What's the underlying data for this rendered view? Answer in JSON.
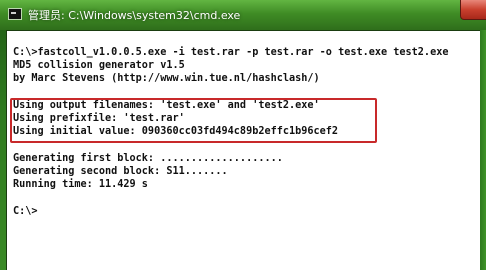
{
  "window": {
    "title": "管理员: C:\\Windows\\system32\\cmd.exe"
  },
  "console": {
    "lines": [
      "C:\\>fastcoll_v1.0.0.5.exe -i test.rar -p test.rar -o test.exe test2.exe",
      "MD5 collision generator v1.5",
      "by Marc Stevens (http://www.win.tue.nl/hashclash/)",
      "",
      "Using output filenames: 'test.exe' and 'test2.exe'",
      "Using prefixfile: 'test.rar'",
      "Using initial value: 090360cc03fd494c89b2effc1b96cef2",
      "",
      "Generating first block: ....................",
      "Generating second block: S11.......",
      "Running time: 11.429 s",
      "",
      "C:\\>"
    ]
  },
  "colors": {
    "highlight_border": "#c8292a",
    "console_background": "#ffffff",
    "console_text": "#111111",
    "titlebar": "#3f8c25"
  }
}
